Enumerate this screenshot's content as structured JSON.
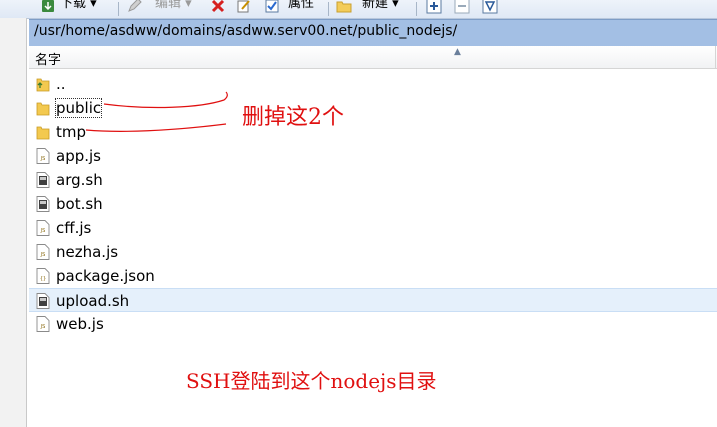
{
  "toolbar": {
    "download_label": "下载 ▾",
    "edit_label": "编辑 ▾",
    "properties_label": "属性",
    "new_label": "新建 ▾"
  },
  "path": "/usr/home/asdww/domains/asdww.serv00.net/public_nodejs/",
  "header": {
    "name_col": "名字"
  },
  "files": [
    {
      "name": "..",
      "icon": "folder-up-icon"
    },
    {
      "name": "public",
      "icon": "folder-icon"
    },
    {
      "name": "tmp",
      "icon": "folder-icon"
    },
    {
      "name": "app.js",
      "icon": "js-file-icon"
    },
    {
      "name": "arg.sh",
      "icon": "sh-file-icon"
    },
    {
      "name": "bot.sh",
      "icon": "sh-file-icon"
    },
    {
      "name": "cff.js",
      "icon": "js-file-icon"
    },
    {
      "name": "nezha.js",
      "icon": "js-file-icon"
    },
    {
      "name": "package.json",
      "icon": "json-file-icon"
    },
    {
      "name": "upload.sh",
      "icon": "sh-file-icon",
      "selected": true
    },
    {
      "name": "web.js",
      "icon": "js-file-icon"
    }
  ],
  "annotations": {
    "delete_note": "删掉这2个",
    "ssh_note": "SSH登陆到这个nodejs目录"
  },
  "colors": {
    "annotation": "#e01010",
    "pathbar": "#a3bfe4",
    "selection": "#e5f0fb"
  }
}
